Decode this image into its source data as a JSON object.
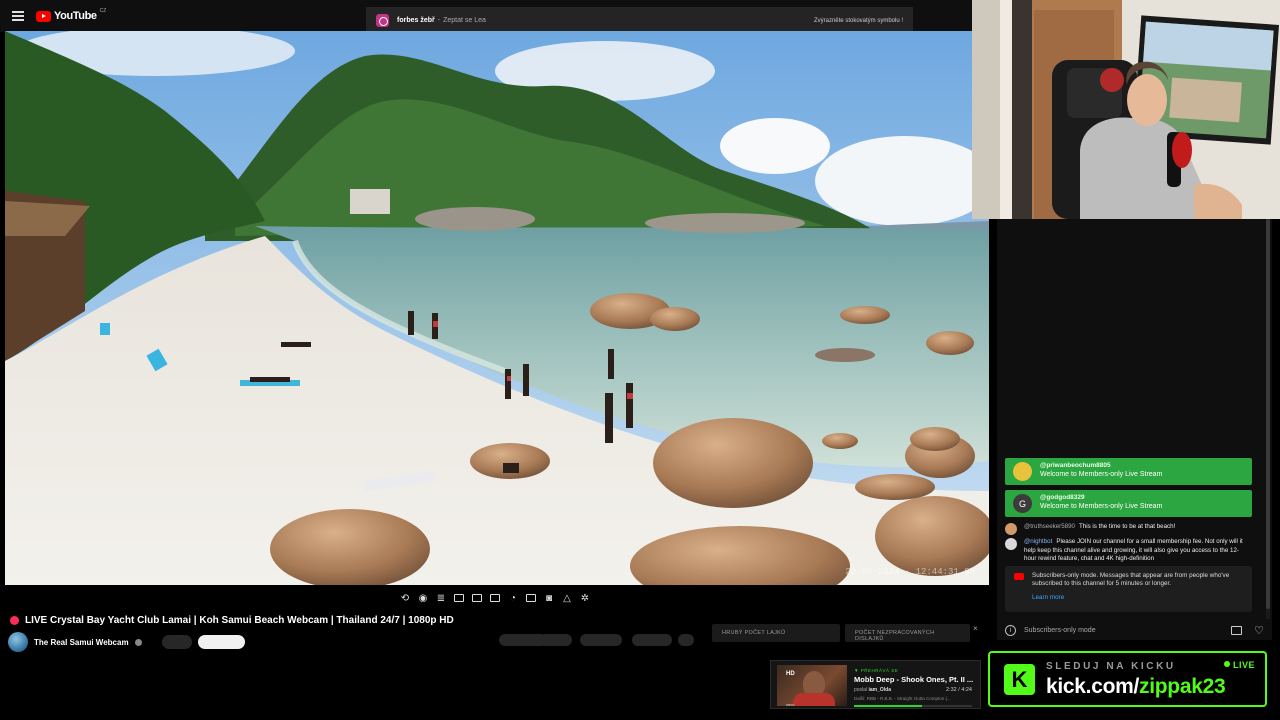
{
  "app": {
    "name": "YouTube",
    "region_label": "CZ"
  },
  "notification": {
    "user": "forbes žebř",
    "separator": "-",
    "message": "Zeptat se Lea",
    "right_text": "Zvýrazněte stokovatým symbolu !"
  },
  "video": {
    "title": "LIVE Crystal Bay Yacht Club Lamai | Koh Samui Beach Webcam | Thailand 24/7 | 1080p HD",
    "channel": "The Real Samui Webcam",
    "timestamp": "22-08-2024 · 12:44:31 SH"
  },
  "stats": {
    "likes_label": "HRUBÝ POČET LAJKŮ",
    "dislikes_label": "POČET NEZPRACOVANÝCH DISLAJKŮ",
    "close": "×"
  },
  "chat": {
    "member_messages": [
      {
        "user": "@priwanbeochum8805",
        "text": "Welcome to Members-only Live Stream",
        "avatar_color": "#e8c23a"
      },
      {
        "user": "@godgod8329",
        "text": "Welcome to Members-only Live Stream",
        "avatar_color": "#3b3b3b",
        "avatar_letter": "G"
      }
    ],
    "messages": [
      {
        "user": "@truthseeker5890",
        "text": "This is the time to be at that beach!",
        "avatar_color": "#d29a6a"
      },
      {
        "user": "@nightbot",
        "text": "Please JOIN our channel for a small membership fee. Not only will it help keep this channel alive and growing, it will also give you access to the 12-hour rewind feature, chat and 4K high-definition",
        "avatar_color": "#d9d9d9"
      }
    ],
    "subscribers_notice": "Subscribers-only mode. Messages that appear are from people who've subscribed to this channel for 5 minutes or longer.",
    "learn_more": "Learn more",
    "input_mode": "Subscribers-only mode"
  },
  "now_playing": {
    "badge": "HD",
    "vevo": "vevo",
    "kicker": "▼ PŘEHRÁVÁ SE",
    "title": "Mobb Deep - Shook Ones, Pt. II ...",
    "posted_prefix": "poslal",
    "posted_by": "iam_Olda",
    "time": "2:32 / 4:24",
    "next": "Další: RBB - R.B.B. - Straight Outta Compton (...",
    "progress": 0.58
  },
  "kick_banner": {
    "logo_letter": "K",
    "headline": "SLEDUJ NA KICKU",
    "live": "LIVE",
    "url_prefix": "kick.com/",
    "url_name": "zippak23"
  },
  "colors": {
    "youtube_red": "#ff0000",
    "member_green": "#2ba640",
    "kick_green": "#53fc18",
    "link_blue": "#3ea6ff"
  }
}
